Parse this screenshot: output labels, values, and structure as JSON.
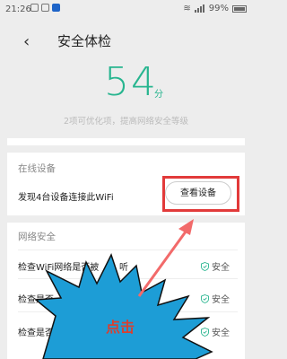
{
  "status_bar": {
    "time": "21:26",
    "battery": "99%"
  },
  "header": {
    "title": "安全体检",
    "score": "54",
    "score_unit": "分",
    "subtitle": "2项可优化项，提高网络安全等级"
  },
  "online_devices": {
    "section_title": "在线设备",
    "message": "发现4台设备连接此WiFi",
    "button_label": "查看设备"
  },
  "network_security": {
    "section_title": "网络安全",
    "rows": [
      {
        "label": "检查WiFi网络是否被",
        "tail": "听",
        "status": "安全"
      },
      {
        "label": "检查是否",
        "tail": "",
        "status": "安全"
      },
      {
        "label": "检查是否",
        "tail": "",
        "status": "安全"
      }
    ]
  },
  "annotation": {
    "label": "点击"
  },
  "colors": {
    "accent": "#27b58f",
    "highlight": "#e23a3a",
    "burst_fill": "#1d9dd6",
    "arrow": "#f26a6a"
  }
}
